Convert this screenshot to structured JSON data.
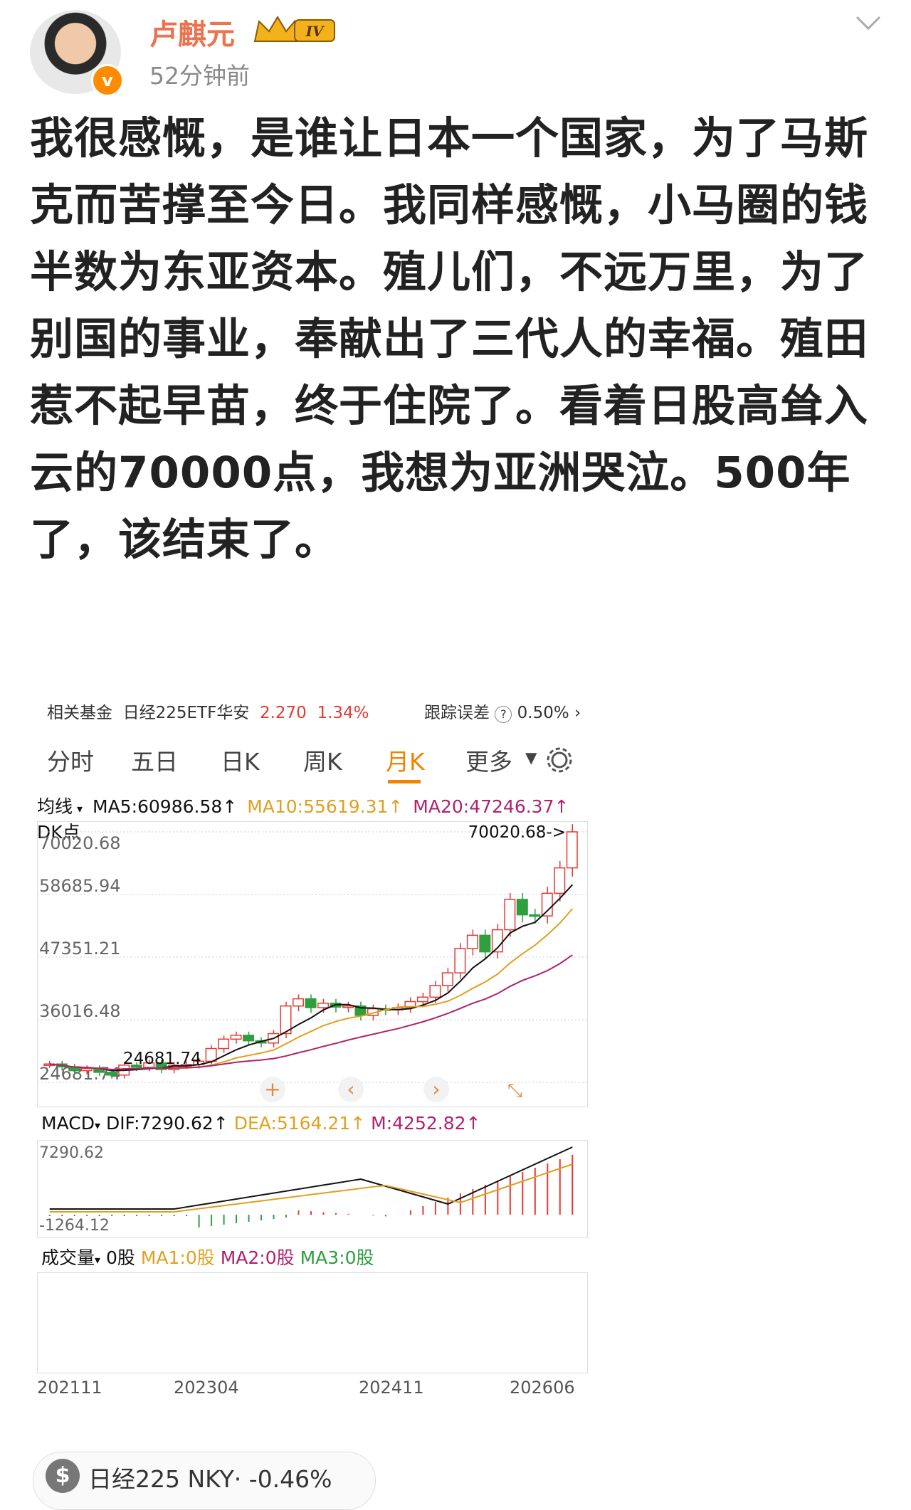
{
  "post": {
    "username": "卢麒元",
    "level_badge": "IV",
    "timestamp": "52分钟前",
    "avatar_badge": "v",
    "text": "我很感慨，是谁让日本一个国家，为了马斯克而苦撑至今日。我同样感慨，小马圈的钱半数为东亚资本。殖儿们，不远万里，为了别国的事业，奉献出了三代人的幸福。殖田惹不起早苗，终于住院了。看着日股高耸入云的70000点，我想为亚洲哭泣。500年了，该结束了。"
  },
  "fund": {
    "label": "相关基金",
    "name": "日经225ETF华安",
    "price": "2.270",
    "change": "1.34%",
    "tracking_label": "跟踪误差",
    "tracking_value": "0.50%"
  },
  "tabs": [
    "分时",
    "五日",
    "日K",
    "周K",
    "月K",
    "更多"
  ],
  "active_tab": "月K",
  "ma": {
    "label": "均线",
    "ma5": "MA5:60986.58↑",
    "ma10": "MA10:55619.31↑",
    "ma20": "MA20:47246.37↑",
    "dk": "DK点"
  },
  "macd": {
    "label": "MACD",
    "dif": "DIF:7290.62↑",
    "dea": "DEA:5164.21↑",
    "m": "M:4252.82↑",
    "top": "7290.62",
    "bottom": "-1264.12"
  },
  "volume": {
    "label": "成交量",
    "v": "0股",
    "ma1": "MA1:0股",
    "ma2": "MA2:0股",
    "ma3": "MA3:0股"
  },
  "chart_data": {
    "type": "candlestick",
    "y_ticks": [
      "70020.68",
      "58685.94",
      "47351.21",
      "36016.48",
      "24681.74"
    ],
    "high_marker": "70020.68->",
    "low_marker": "24681.74",
    "x_labels": [
      "202111",
      "202304",
      "202411",
      "202606"
    ],
    "ylim": [
      24681.74,
      70020.68
    ]
  },
  "stock": {
    "symbol": "$",
    "name": "日经225 NKY",
    "change": "-0.46%"
  },
  "colors": {
    "accent": "#f08300",
    "up": "#e53935",
    "down": "#2e9e3e",
    "ma5": "#111111",
    "ma10": "#e0a020",
    "ma20": "#b0226e"
  }
}
